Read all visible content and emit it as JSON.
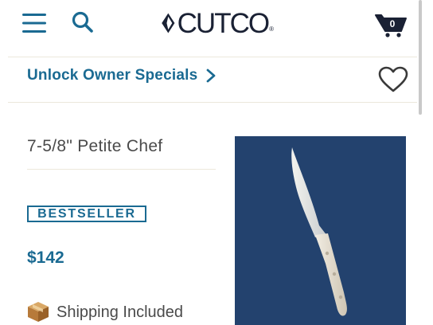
{
  "header": {
    "logo_text": "CUTCO",
    "logo_reg": "®",
    "cart_count": "0"
  },
  "promo": {
    "label": "Unlock Owner Specials"
  },
  "product": {
    "name": "7-5/8\" Petite Chef",
    "badge": "BESTSELLER",
    "price": "$142",
    "shipping": "Shipping Included"
  },
  "icons": {
    "menu": "hamburger-menu-icon",
    "search": "search-icon",
    "cart": "cart-icon",
    "chevron": "chevron-right-icon",
    "favorite": "heart-outline-icon",
    "shipping": "package-box-icon"
  },
  "colors": {
    "accent": "#1a6a92",
    "logo": "#1a2134",
    "image_background": "#23426e"
  }
}
